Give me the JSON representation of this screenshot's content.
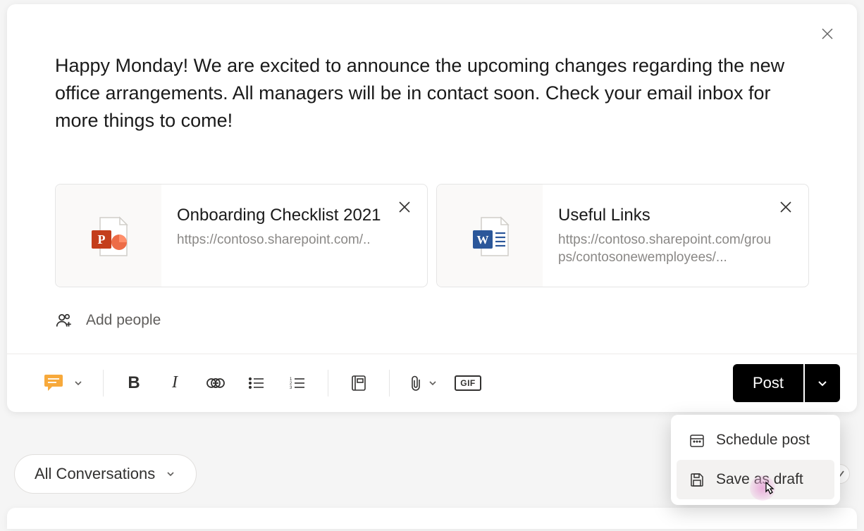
{
  "compose": {
    "message": "Happy Monday! We are excited to announce the upcoming changes regarding the new office arrangements. All managers will be in contact soon. Check your email inbox for more things to come!",
    "add_people_label": "Add people"
  },
  "attachments": [
    {
      "type": "powerpoint",
      "title": "Onboarding Checklist 2021",
      "url": "https://contoso.sharepoint.com/.."
    },
    {
      "type": "word",
      "title": "Useful Links",
      "url": "https://contoso.sharepoint.com/groups/contosonewemployees/..."
    }
  ],
  "toolbar": {
    "post_label": "Post",
    "gif_label": "GIF"
  },
  "post_menu": {
    "schedule_label": "Schedule post",
    "draft_label": "Save as draft"
  },
  "filter": {
    "label": "All Conversations"
  }
}
